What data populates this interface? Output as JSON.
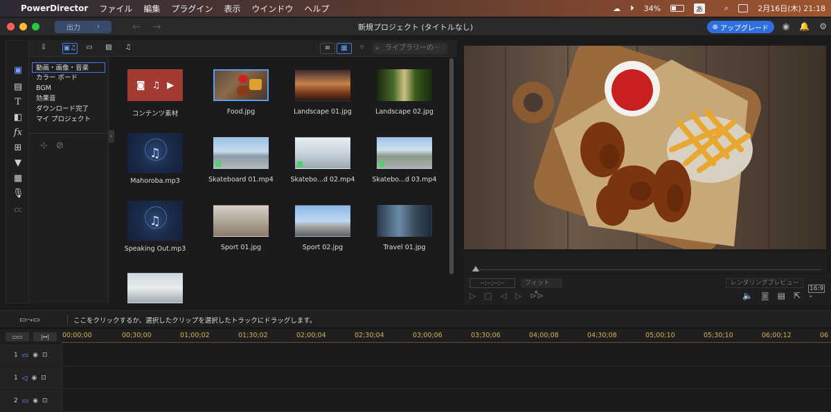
{
  "menubar": {
    "app": "PowerDirector",
    "items": [
      "ファイル",
      "編集",
      "プラグイン",
      "表示",
      "ウインドウ",
      "ヘルプ"
    ],
    "battery": "34%",
    "ime": "あ",
    "datetime": "2月16日(木) 21:18"
  },
  "window": {
    "output_label": "出力",
    "title": "新規プロジェクト (タイトルなし)",
    "upgrade_label": "アップグレード"
  },
  "library": {
    "search_placeholder": "ライブラリーの···",
    "categories": [
      "動画・画像・音楽",
      "カラー ボード",
      "BGM",
      "効果音",
      "ダウンロード完了",
      "マイ プロジェクト"
    ],
    "items": [
      "コンテンツ素材",
      "Food.jpg",
      "Landscape 01.jpg",
      "Landscape 02.jpg",
      "Mahoroba.mp3",
      "Skateboard 01.mp4",
      "Skatebo...d 02.mp4",
      "Skatebo...d 03.mp4",
      "Speaking Out.mp3",
      "Sport 01.jpg",
      "Sport 02.jpg",
      "Travel 01.jpg"
    ]
  },
  "preview": {
    "timecode": "--;--;--;--",
    "fit_label": "フィット",
    "render_label": "レンダリングプレビュー",
    "ratio": "16:9"
  },
  "timeline": {
    "hint": "ここをクリックするか、選択したクリップを選択したトラックにドラッグします。",
    "ruler": [
      "00;00;00",
      "00;30;00",
      "01;00;02",
      "01;30;02",
      "02;00;04",
      "02;30;04",
      "03;00;06",
      "03;30;06",
      "04;00;08",
      "04;30;08",
      "05;00;10",
      "05;30;10",
      "06;00;12",
      "06"
    ],
    "tracks": [
      {
        "num": "1",
        "type": "video"
      },
      {
        "num": "1",
        "type": "audio"
      },
      {
        "num": "2",
        "type": "video"
      }
    ]
  },
  "colors": {
    "accent": "#3f7de8",
    "upgrade": "#2f6fe0",
    "content_tile": "#a43b32",
    "ruler_text": "#d4b24a"
  }
}
